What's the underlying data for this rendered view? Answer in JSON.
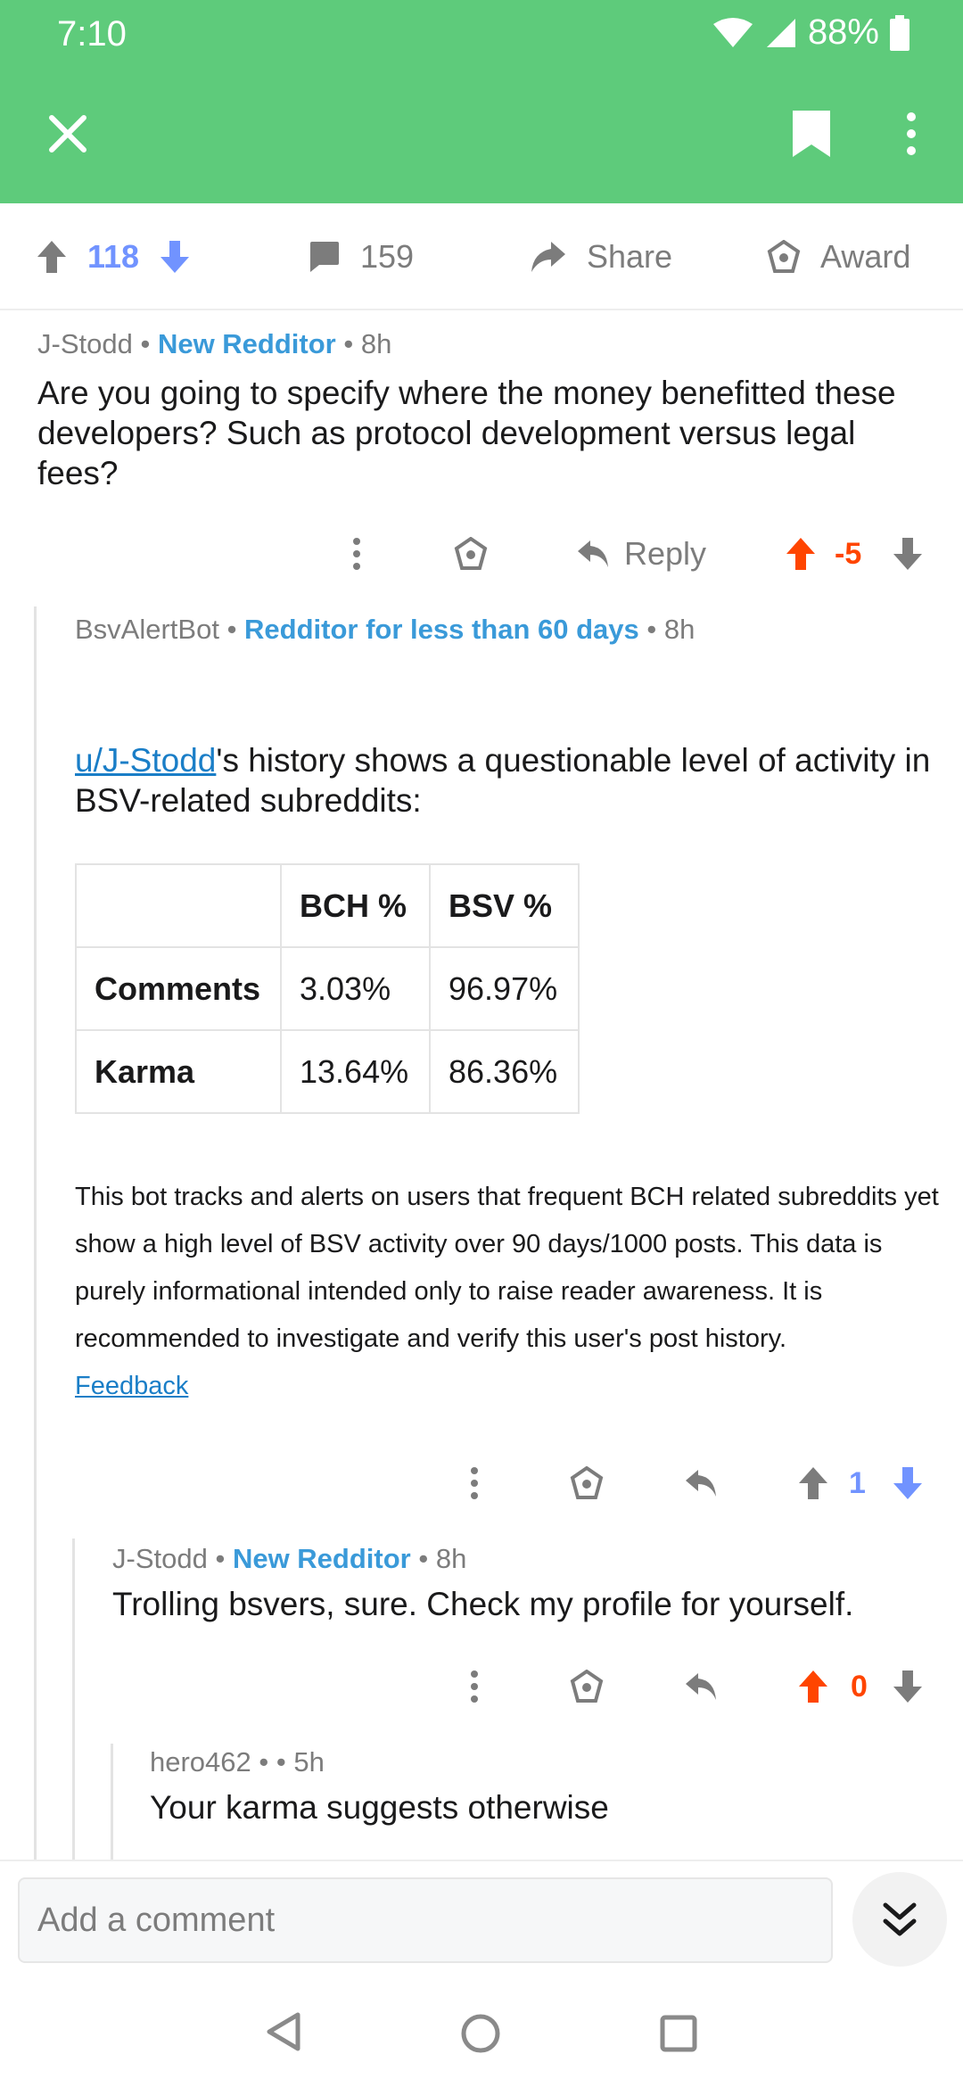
{
  "status_bar": {
    "time": "7:10",
    "battery": "88%"
  },
  "app_bar": {
    "close_icon": "close-icon",
    "bookmark_icon": "bookmark-icon",
    "more_icon": "more-vertical-icon"
  },
  "post_actions": {
    "score": "118",
    "comments": "159",
    "share": "Share",
    "award": "Award"
  },
  "comments": [
    {
      "author": "J-Stodd",
      "flair": "New Redditor",
      "age": "8h",
      "body": "Are you going to specify where the money benefitted these developers? Such as protocol development versus legal fees?",
      "reply_label": "Reply",
      "score": "-5"
    },
    {
      "author": "BsvAlertBot",
      "flair": "Redditor for less than 60 days",
      "age": "8h",
      "mention": "u/J-Stodd",
      "body_rest": "'s history shows a questionable level of activity in BSV-related subreddits:",
      "table": {
        "headers": [
          "",
          "BCH %",
          "BSV %"
        ],
        "rows": [
          {
            "label": "Comments",
            "bch": "3.03%",
            "bsv": "96.97%"
          },
          {
            "label": "Karma",
            "bch": "13.64%",
            "bsv": "86.36%"
          }
        ]
      },
      "note": "This bot tracks and alerts on users that frequent BCH related subreddits yet show a high level of BSV activity over 90 days/1000 posts. This data is purely informational intended only to raise reader awareness. It is recommended to investigate and verify this user's post history.",
      "feedback": "Feedback",
      "score": "1"
    },
    {
      "author": "J-Stodd",
      "flair": "New Redditor",
      "age": "8h",
      "body": "Trolling bsvers, sure. Check my profile for yourself.",
      "score": "0"
    },
    {
      "author": "hero462",
      "flair": "",
      "age": "5h",
      "body": "Your karma suggests otherwise"
    }
  ],
  "composer": {
    "placeholder": "Add a comment"
  },
  "colors": {
    "header": "#5ecb7b",
    "upvote": "#ff4500",
    "downvote": "#7193ff",
    "flair": "#3a9ad9"
  }
}
